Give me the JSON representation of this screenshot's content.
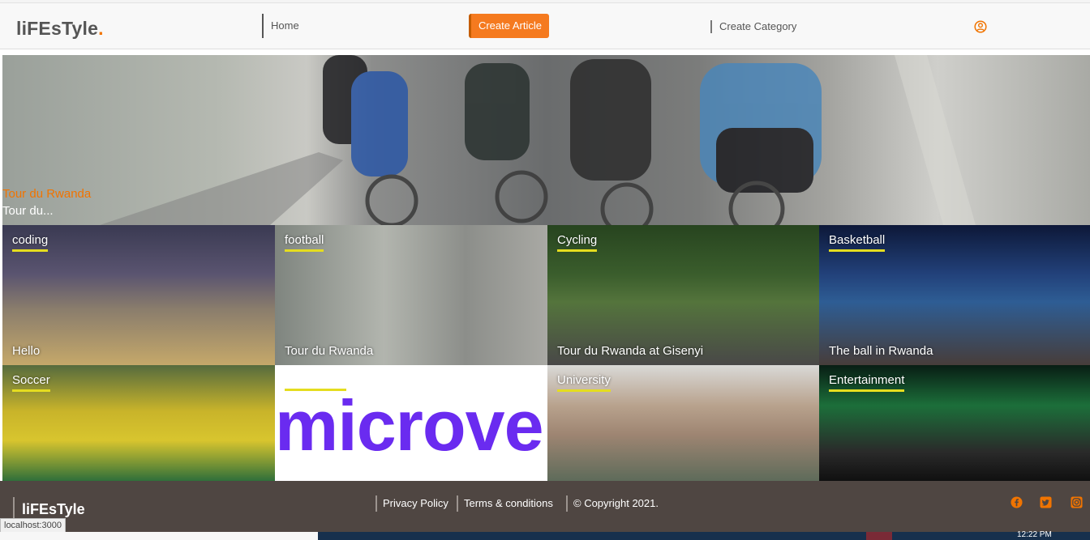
{
  "brand": {
    "name": "liFEsTyle",
    "dot": ".",
    "accent_color": "#f17400"
  },
  "nav": {
    "home": "Home",
    "create_article": "Create Article",
    "create_category": "Create Category",
    "user_icon": "user-circle-icon"
  },
  "hero": {
    "category": "Tour du Rwanda",
    "excerpt": "Tour du..."
  },
  "tiles": [
    {
      "category": "coding",
      "title": "Hello"
    },
    {
      "category": "football",
      "title": "Tour du Rwanda"
    },
    {
      "category": "Cycling",
      "title": "Tour du Rwanda at Gisenyi"
    },
    {
      "category": "Basketball",
      "title": "The ball in Rwanda"
    },
    {
      "category": "Soccer",
      "title": ""
    },
    {
      "category": "",
      "title": "",
      "image_text": "microve"
    },
    {
      "category": "University",
      "title": ""
    },
    {
      "category": "Entertainment",
      "title": ""
    }
  ],
  "footer": {
    "brand": "liFEsTyle",
    "links": [
      "Privacy Policy",
      "Terms & conditions",
      "© Copyright 2021."
    ],
    "social_icons": [
      "facebook-icon",
      "twitter-icon",
      "instagram-icon"
    ],
    "social_color": "#f17400"
  },
  "status_bar": {
    "url": "localhost:3000"
  },
  "taskbar": {
    "time": "12:22 PM"
  }
}
